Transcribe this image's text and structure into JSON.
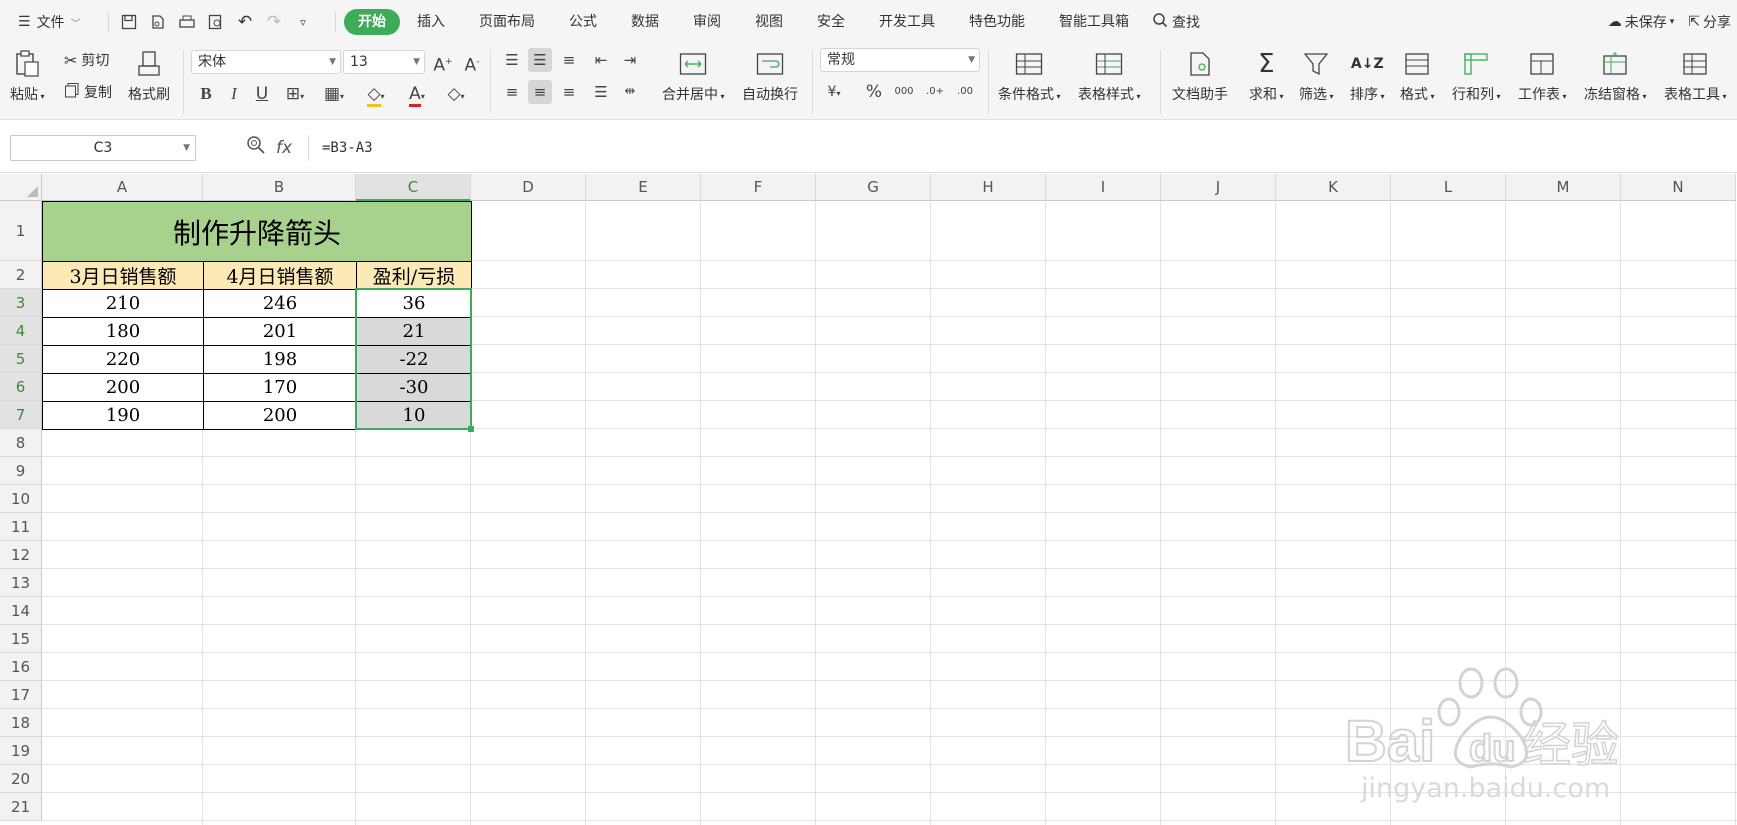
{
  "menubar": {
    "file": "文件",
    "tabs": [
      "开始",
      "插入",
      "页面布局",
      "公式",
      "数据",
      "审阅",
      "视图",
      "安全",
      "开发工具",
      "特色功能",
      "智能工具箱"
    ],
    "search": "查找",
    "unsaved": "未保存",
    "share": "分享"
  },
  "ribbon": {
    "paste": "粘贴",
    "cut": "剪切",
    "copy": "复制",
    "format_painter": "格式刷",
    "font_name": "宋体",
    "font_size": "13",
    "merge_center": "合并居中",
    "wrap_text": "自动换行",
    "number_format": "常规",
    "conditional_format": "条件格式",
    "table_style": "表格样式",
    "doc_assistant": "文档助手",
    "sum": "求和",
    "filter": "筛选",
    "sort": "排序",
    "format": "格式",
    "row_col": "行和列",
    "worksheet": "工作表",
    "freeze": "冻结窗格",
    "table_tools": "表格工具"
  },
  "formula_bar": {
    "name_box": "C3",
    "fx": "fx",
    "formula": "=B3-A3"
  },
  "columns": [
    "A",
    "B",
    "C",
    "D",
    "E",
    "F",
    "G",
    "H",
    "I",
    "J",
    "K",
    "L",
    "M",
    "N"
  ],
  "rows": [
    "1",
    "2",
    "3",
    "4",
    "5",
    "6",
    "7",
    "8",
    "9",
    "10",
    "11",
    "12",
    "13",
    "14",
    "15",
    "16",
    "17",
    "18",
    "19",
    "20",
    "21"
  ],
  "sheet": {
    "title": "制作升降箭头",
    "headers": [
      "3月日销售额",
      "4月日销售额",
      "盈利/亏损"
    ],
    "data": [
      [
        "210",
        "246",
        "36"
      ],
      [
        "180",
        "201",
        "21"
      ],
      [
        "220",
        "198",
        "-22"
      ],
      [
        "200",
        "170",
        "-30"
      ],
      [
        "190",
        "200",
        "10"
      ]
    ]
  },
  "watermark": {
    "logo": "Bai du 经验",
    "url": "jingyan.baidu.com"
  },
  "colors": {
    "accent": "#3cab5a",
    "title_fill": "#a9d18e",
    "header_fill": "#fde9b5",
    "selection_fill": "#d9d9d9"
  }
}
